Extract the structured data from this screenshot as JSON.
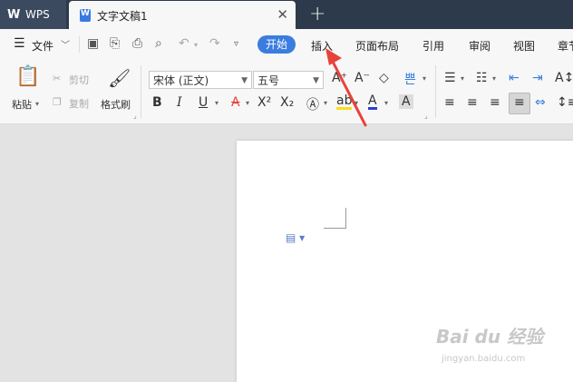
{
  "app": {
    "name": "WPS",
    "logo_glyph": "W"
  },
  "document_tab": {
    "title": "文字文稿1",
    "close_glyph": "✕"
  },
  "new_tab_glyph": "+",
  "menu": {
    "file_label": "文件",
    "tabs": [
      "开始",
      "插入",
      "页面布局",
      "引用",
      "审阅",
      "视图",
      "章节"
    ],
    "active_tab": "开始"
  },
  "ribbon": {
    "paste": "粘贴",
    "cut": "剪切",
    "copy": "复制",
    "format_painter": "格式刷",
    "font_name": "宋体 (正文)",
    "font_size": "五号",
    "phonetic": "쁜"
  },
  "watermark": {
    "brand": "Bai du 经验",
    "url": "jingyan.baidu.com"
  },
  "colors": {
    "accent": "#3b7ddf",
    "tabbar": "#2d3a4c",
    "arrow": "#e8423a"
  }
}
